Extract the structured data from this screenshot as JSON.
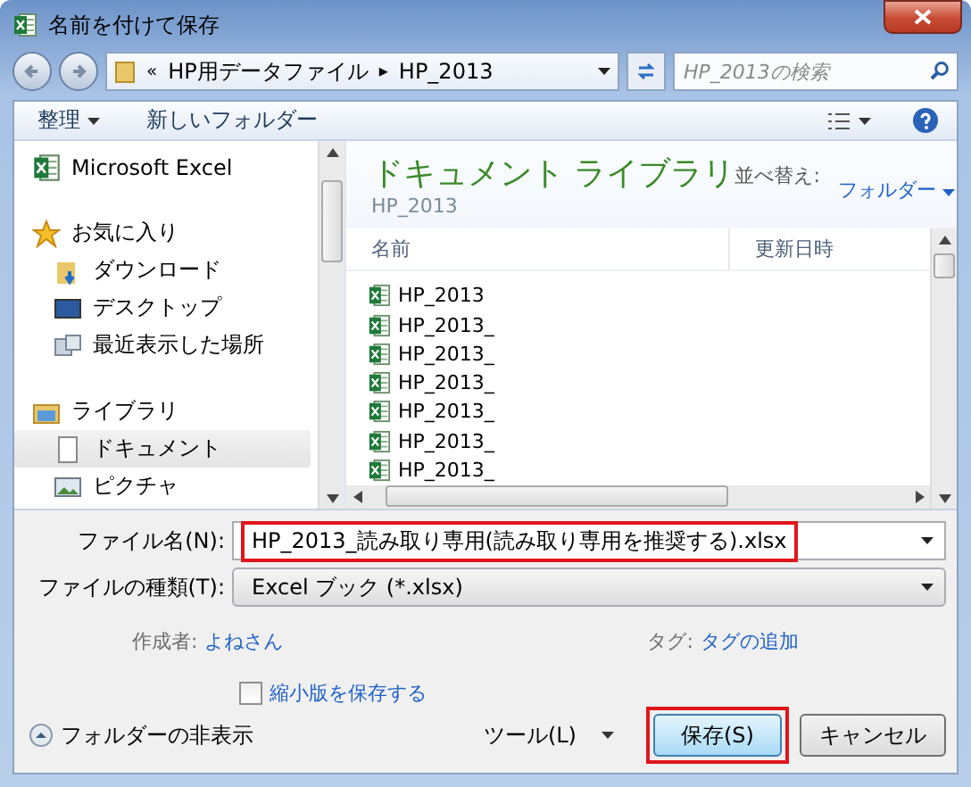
{
  "window": {
    "title": "名前を付けて保存"
  },
  "address": {
    "overflow": "«",
    "crumbs": [
      "HP用データファイル",
      "HP_2013"
    ],
    "separator": "▸"
  },
  "search": {
    "placeholder": "HP_2013の検索"
  },
  "toolbar": {
    "organize": "整理",
    "new_folder": "新しいフォルダー"
  },
  "nav": [
    {
      "kind": "app",
      "label": "Microsoft Excel",
      "selected": false
    },
    {
      "kind": "favorites",
      "label": "お気に入り",
      "selected": false
    },
    {
      "kind": "download",
      "label": "ダウンロード",
      "selected": false
    },
    {
      "kind": "desktop",
      "label": "デスクトップ",
      "selected": false
    },
    {
      "kind": "recent",
      "label": "最近表示した場所",
      "selected": false
    },
    {
      "kind": "library",
      "label": "ライブラリ",
      "selected": false
    },
    {
      "kind": "document",
      "label": "ドキュメント",
      "selected": true
    },
    {
      "kind": "picture",
      "label": "ピクチャ",
      "selected": false
    }
  ],
  "library": {
    "title": "ドキュメント ライブラリ",
    "subtitle": "HP_2013",
    "sort_label": "並べ替え:",
    "sort_value": "フォルダー"
  },
  "columns": [
    "名前",
    "更新日時"
  ],
  "files": [
    "HP_2013",
    "HP_2013_",
    "HP_2013_",
    "HP_2013_",
    "HP_2013_",
    "HP_2013_",
    "HP_2013_"
  ],
  "form": {
    "filename_label": "ファイル名(N):",
    "filename": "HP_2013_読み取り専用(読み取り専用を推奨する).xlsx",
    "filename_highlighted": true,
    "type_label": "ファイルの種類(T):",
    "type": "Excel ブック (*.xlsx)",
    "author_label": "作成者:",
    "author": "よねさん",
    "tag_label": "タグ:",
    "tag": "タグの追加",
    "thumbnail_label": "縮小版を保存する",
    "thumbnail_checked": false
  },
  "footer": {
    "hide_folders": "フォルダーの非表示",
    "tools": "ツール(L)",
    "save": "保存(S)",
    "save_highlighted": true,
    "cancel": "キャンセル"
  }
}
